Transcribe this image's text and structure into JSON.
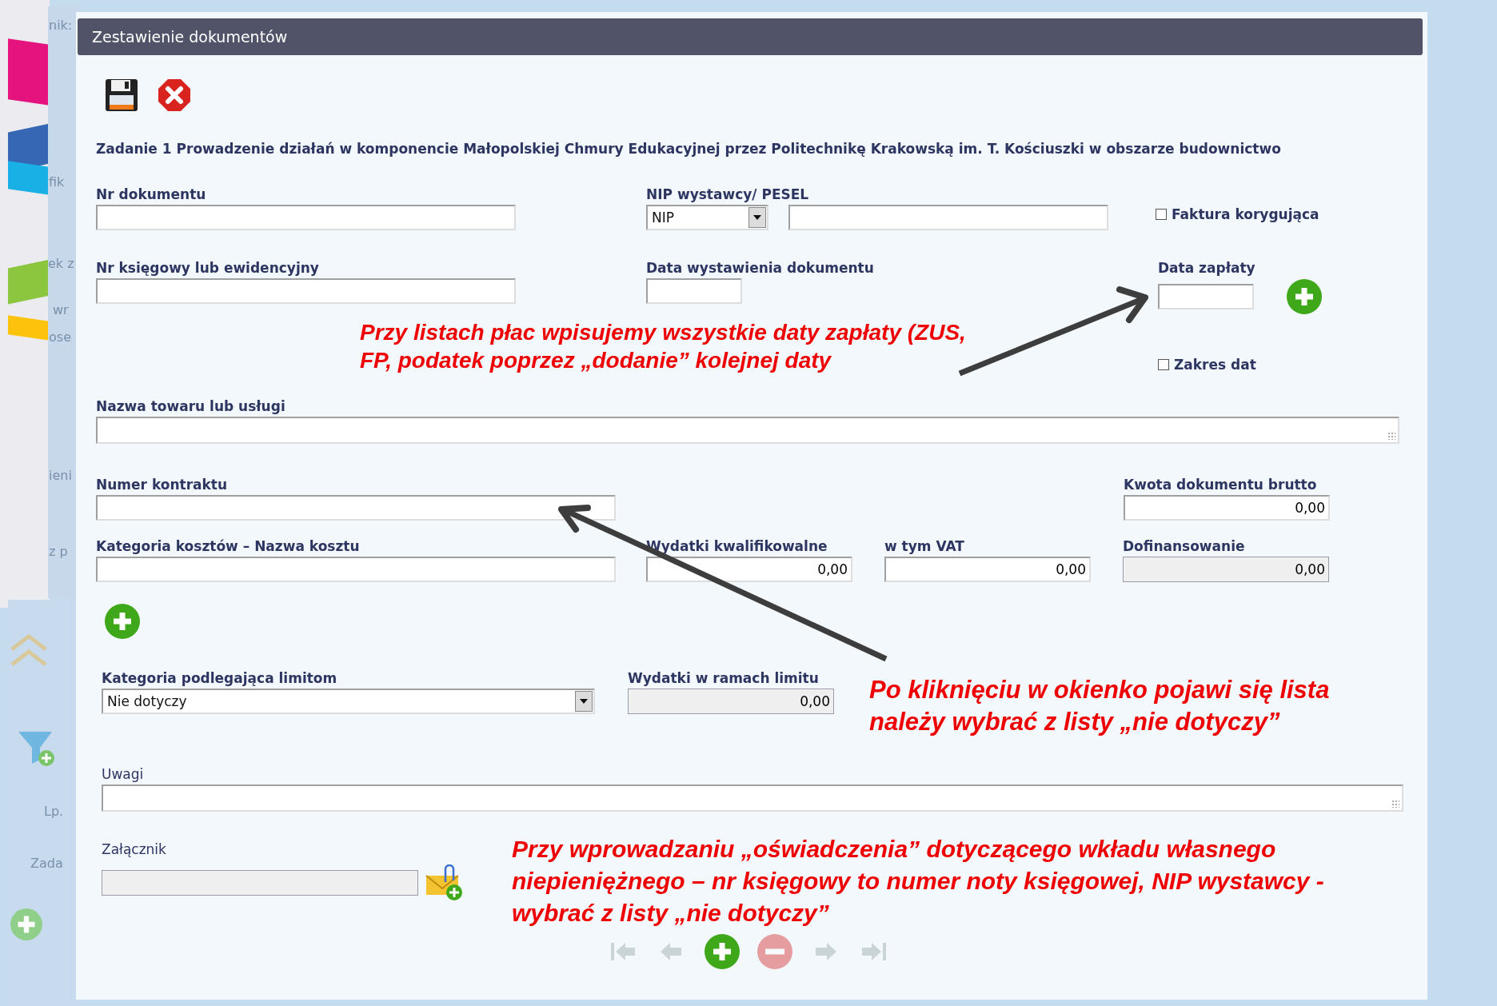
{
  "dialog_title": "Zestawienie dokumentów",
  "toolbar": [
    {
      "kind": "save"
    },
    {
      "kind": "cancel"
    }
  ],
  "task": "Zadanie 1 Prowadzenie działań w komponencie Małopolskiej Chmury Edukacyjnej przez Politechnikę Krakowską im. T. Kościuszki w obszarze budownictwo",
  "nr_dokumentu": {
    "label": "Nr dokumentu"
  },
  "nip": {
    "label": "NIP wystawcy/ PESEL",
    "type_value": "NIP"
  },
  "faktura_korygujaca": {
    "label": "Faktura korygująca",
    "checked": false
  },
  "nr_ksiegowy": {
    "label": "Nr księgowy lub ewidencyjny"
  },
  "data_wystawienia": {
    "label": "Data wystawienia dokumentu"
  },
  "data_zaplaty": {
    "label": "Data zapłaty"
  },
  "zakres_dat": {
    "label": "Zakres dat",
    "checked": false
  },
  "nazwa_towaru": {
    "label": "Nazwa towaru lub usługi"
  },
  "numer_kontraktu": {
    "label": "Numer kontraktu"
  },
  "kwota_brutto": {
    "label": "Kwota dokumentu brutto",
    "value": "0,00",
    "disabled": false
  },
  "kategoria_kosztow": {
    "label": "Kategoria kosztów – Nazwa kosztu"
  },
  "amounts": [
    {
      "label": "Wydatki kwalifikowalne",
      "value": "0,00",
      "disabled": false
    },
    {
      "label": "w tym VAT",
      "value": "0,00",
      "disabled": false
    },
    {
      "label": "Dofinansowanie",
      "value": "0,00",
      "disabled": true
    }
  ],
  "kategoria_limit": {
    "label": "Kategoria podlegająca limitom",
    "value": "Nie dotyczy"
  },
  "wydatki_limit": {
    "label": "Wydatki w ramach limitu",
    "value": "0,00",
    "disabled": true
  },
  "uwagi": {
    "label": "Uwagi"
  },
  "zalacznik": {
    "label": "Załącznik",
    "disabled": true
  },
  "navigation": [
    {
      "kind": "first",
      "disabled": true
    },
    {
      "kind": "prev",
      "disabled": true
    },
    {
      "kind": "add",
      "disabled": false
    },
    {
      "kind": "remove",
      "disabled": true
    },
    {
      "kind": "next",
      "disabled": true
    },
    {
      "kind": "last",
      "disabled": true
    }
  ],
  "annotations": [
    "Przy listach płac wpisujemy wszystkie daty zapłaty (ZUS, FP, podatek poprzez „dodanie” kolejnej daty",
    "Po kliknięciu w okienko pojawi się lista należy wybrać z listy „nie dotyczy”",
    "Przy wprowadzaniu „oświadczenia” dotyczącego wkładu własnego niepieniężnego – nr księgowy to numer noty księgowej, NIP wystawcy - wybrać z listy „nie dotyczy”"
  ],
  "background_fragments": [
    "nik:",
    "fik",
    "ek z",
    "wr",
    "ose",
    "ieni",
    "z p",
    "Lp.",
    "Zada"
  ]
}
